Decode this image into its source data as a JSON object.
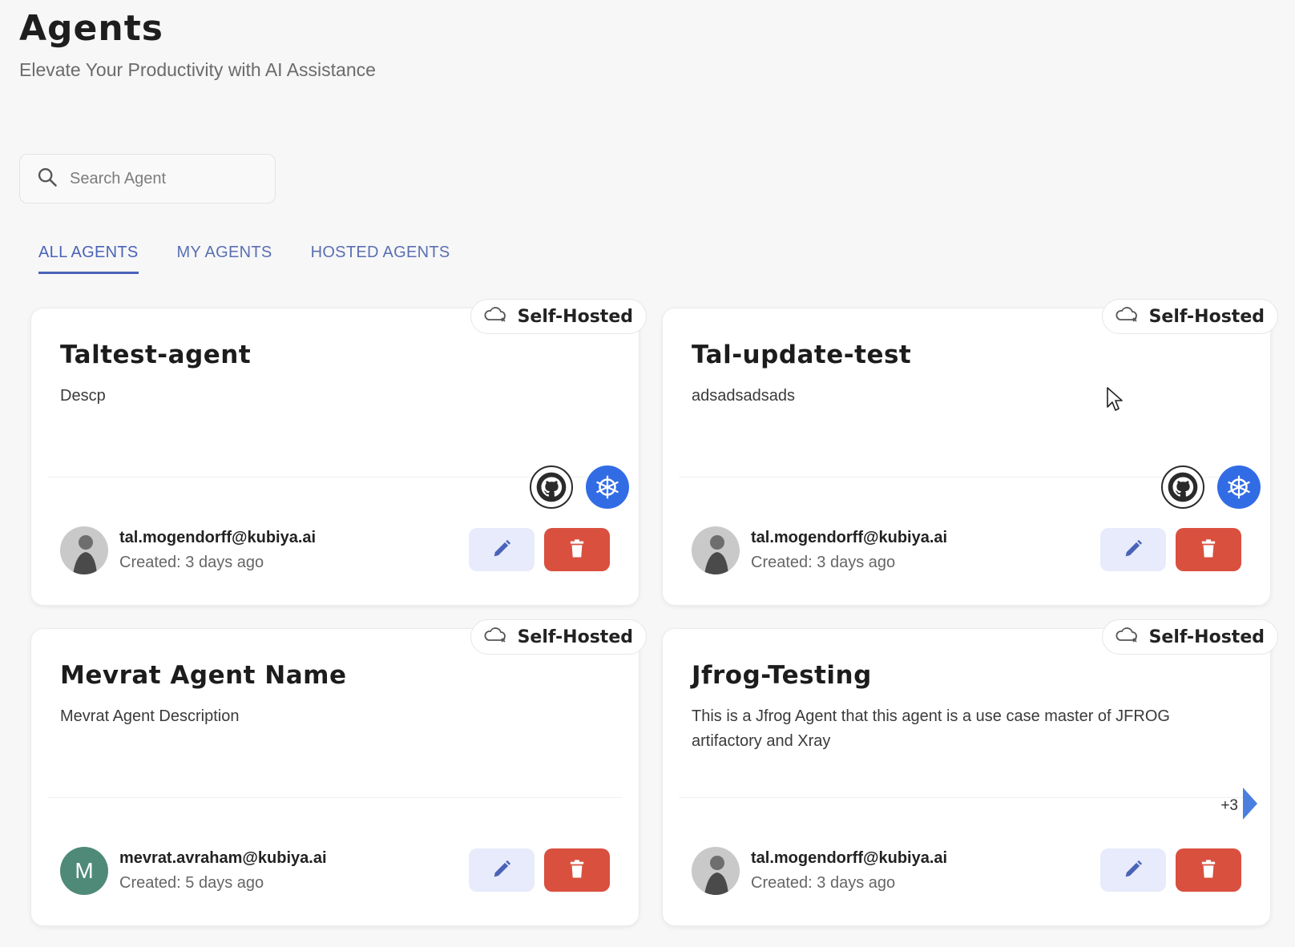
{
  "page": {
    "title": "Agents",
    "subtitle": "Elevate Your Productivity with AI Assistance"
  },
  "search": {
    "placeholder": "Search Agent",
    "value": "",
    "icon": "search-icon"
  },
  "tabs": [
    {
      "label": "ALL AGENTS",
      "active": true
    },
    {
      "label": "MY AGENTS",
      "active": false
    },
    {
      "label": "HOSTED AGENTS",
      "active": false
    }
  ],
  "agents": [
    {
      "badge": "Self-Hosted",
      "name": "Taltest-agent",
      "description": "Descp",
      "integrations": [
        "github-icon",
        "kubernetes-icon"
      ],
      "owner_email": "tal.mogendorff@kubiya.ai",
      "created": "Created: 3 days ago",
      "avatar": "photo"
    },
    {
      "badge": "Self-Hosted",
      "name": "Tal-update-test",
      "description": "adsadsadsads",
      "integrations": [
        "github-icon",
        "kubernetes-icon"
      ],
      "owner_email": "tal.mogendorff@kubiya.ai",
      "created": "Created: 3 days ago",
      "avatar": "photo"
    },
    {
      "badge": "Self-Hosted",
      "name": "Mevrat Agent Name",
      "description": "Mevrat Agent Description",
      "integrations": [],
      "owner_email": "mevrat.avraham@kubiya.ai",
      "created": "Created: 5 days ago",
      "avatar": "letter",
      "avatar_letter": "M"
    },
    {
      "badge": "Self-Hosted",
      "name": "Jfrog-Testing",
      "description": "This is a Jfrog Agent that this agent is a use case master of JFROG artifactory and Xray",
      "integrations": [],
      "more_count": "+3",
      "owner_email": "tal.mogendorff@kubiya.ai",
      "created": "Created: 3 days ago",
      "avatar": "photo"
    }
  ],
  "colors": {
    "accent": "#4a63b8",
    "delete": "#d9503f",
    "edit_bg": "#e8ebfb",
    "kubernetes": "#326ce5",
    "avatar_letter_bg": "#4e8a77"
  }
}
